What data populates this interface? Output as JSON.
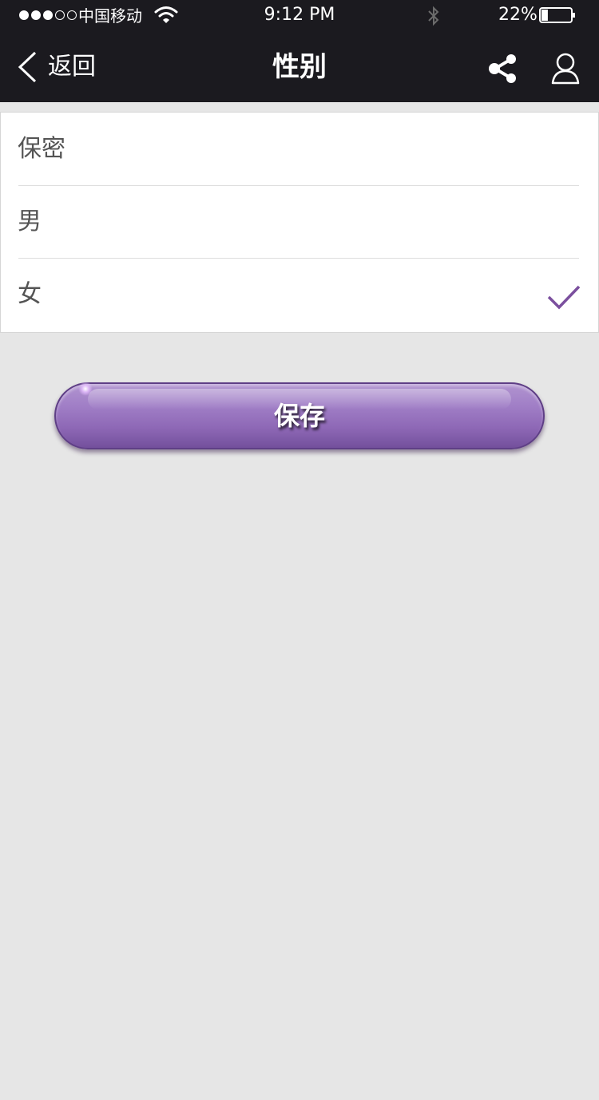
{
  "status_bar": {
    "carrier": "中国移动",
    "time": "9:12 PM",
    "battery_percent": "22%",
    "battery_level": 0.22,
    "signal_bars_filled": 3,
    "signal_bars_total": 5
  },
  "nav": {
    "back_label": "返回",
    "title": "性别",
    "share_icon": "share-icon",
    "user_icon": "user-icon"
  },
  "options": [
    {
      "label": "保密",
      "selected": false
    },
    {
      "label": "男",
      "selected": false
    },
    {
      "label": "女",
      "selected": true
    }
  ],
  "save_button": {
    "label": "保存"
  },
  "colors": {
    "topbar": "#1b1a1f",
    "accent": "#7b4f9e",
    "background": "#e6e6e6",
    "button": "#a07ec6"
  }
}
